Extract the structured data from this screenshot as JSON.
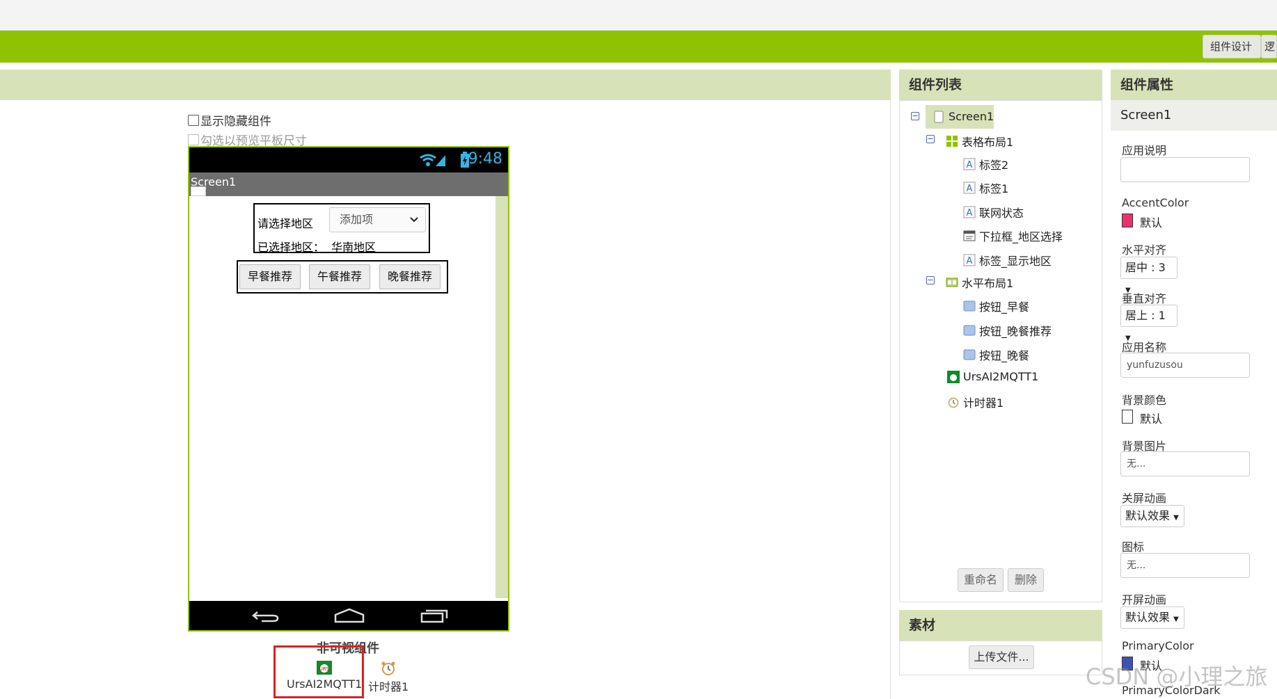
{
  "toolbar": {
    "designer_label": "组件设计",
    "blocks_label": "逻"
  },
  "viewer": {
    "show_hidden_label": "显示隐藏组件",
    "tablet_preview_label": "勾选以预览平板尺寸"
  },
  "phone": {
    "time": "9:48",
    "screen_title": "Screen1",
    "table": {
      "label2": "请选择地区",
      "dropdown_value": "添加项",
      "label1": "已选择地区：",
      "label_region": "华南地区"
    },
    "buttons": [
      "早餐推荐",
      "午餐推荐",
      "晚餐推荐"
    ]
  },
  "nonvisible": {
    "label": "非可视组件",
    "items": [
      "UrsAI2MQTT1",
      "计时器1"
    ]
  },
  "components": {
    "title": "组件列表",
    "tree": [
      {
        "label": "Screen1",
        "icon": "screen-icon"
      },
      {
        "label": "表格布局1",
        "icon": "table-layout-icon"
      },
      {
        "label": "标签2",
        "icon": "label-icon"
      },
      {
        "label": "标签1",
        "icon": "label-icon"
      },
      {
        "label": "联网状态",
        "icon": "label-icon"
      },
      {
        "label": "下拉框_地区选择",
        "icon": "spinner-icon"
      },
      {
        "label": "标签_显示地区",
        "icon": "label-icon"
      },
      {
        "label": "水平布局1",
        "icon": "horizontal-layout-icon"
      },
      {
        "label": "按钮_早餐",
        "icon": "button-icon"
      },
      {
        "label": "按钮_晚餐推荐",
        "icon": "button-icon"
      },
      {
        "label": "按钮_晚餐",
        "icon": "button-icon"
      },
      {
        "label": "UrsAI2MQTT1",
        "icon": "mqtt-icon"
      },
      {
        "label": "计时器1",
        "icon": "clock-icon"
      }
    ],
    "rename_label": "重命名",
    "delete_label": "删除"
  },
  "media": {
    "title": "素材",
    "upload_label": "上传文件..."
  },
  "properties": {
    "title": "组件属性",
    "component": "Screen1",
    "app_desc_label": "应用说明",
    "accent_label": "AccentColor",
    "accent_value": "默认",
    "accent_color": "#e8336d",
    "halign_label": "水平对齐",
    "halign_value": "居中 : 3",
    "valign_label": "垂直对齐",
    "valign_value": "居上 : 1",
    "appname_label": "应用名称",
    "appname_value": "yunfuzusou",
    "bgcolor_label": "背景颜色",
    "bgcolor_value": "默认",
    "bgimage_label": "背景图片",
    "bgimage_value": "无...",
    "close_anim_label": "关屏动画",
    "close_anim_value": "默认效果",
    "icon_label": "图标",
    "icon_value": "无...",
    "open_anim_label": "开屏动画",
    "open_anim_value": "默认效果",
    "primary_label": "PrimaryColor",
    "primary_value": "默认",
    "primary_color": "#3f51b5",
    "primary_dark_label": "PrimaryColorDark"
  },
  "watermark": "CSDN @小理之旅"
}
